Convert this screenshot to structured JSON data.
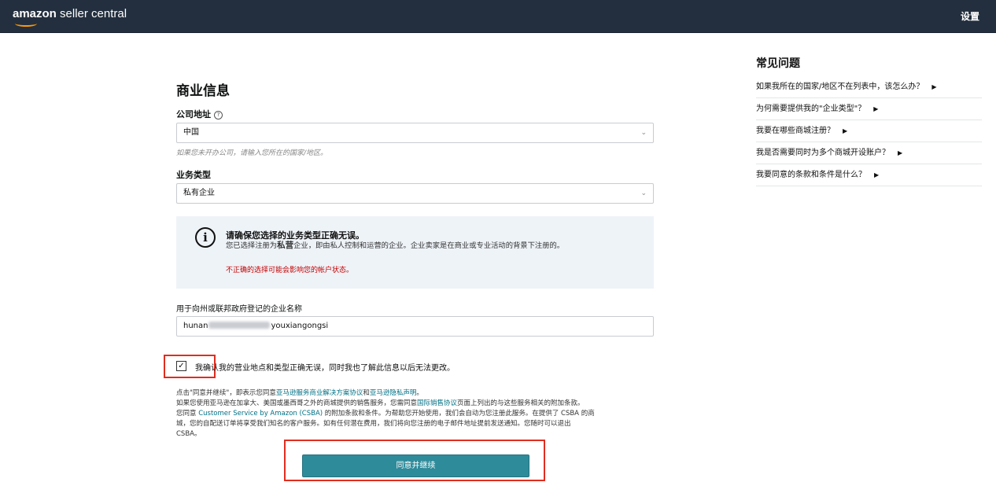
{
  "header": {
    "logo_brand": "amazon",
    "logo_rest": " seller central",
    "settings_label": "设置"
  },
  "form": {
    "title": "商业信息",
    "address_label": "公司地址",
    "address_value": "中国",
    "address_hint": "如果您未开办公司，请输入您所在的国家/地区。",
    "business_type_label": "业务类型",
    "business_type_value": "私有企业",
    "alert": {
      "title": "请确保您选择的业务类型正确无误。",
      "body_prefix": "您已选择注册为",
      "body_strong": "私营",
      "body_suffix": "企业，即由私人控制和运营的企业。企业卖家是在商业或专业活动的背景下注册的。",
      "warning": "不正确的选择可能会影响您的帐户状态。"
    },
    "company_name_label": "用于向州或联邦政府登记的企业名称",
    "company_name_prefix": "hunan",
    "company_name_suffix": "youxiangongsi",
    "confirm_checked": true,
    "confirm_text": "我确认我的营业地点和类型正确无误，同时我也了解此信息以后无法更改。",
    "legal": {
      "l1_a": "点击\"同意并继续\"，即表示您同意",
      "l1_link1": "亚马逊服务商业解决方案协议",
      "l1_b": "和",
      "l1_link2": "亚马逊隐私声明",
      "l1_c": "。",
      "l2_a": "如果您使用亚马逊在加拿大、美国或墨西哥之外的商城提供的销售服务，您需同意",
      "l2_link": "国际销售协议",
      "l2_b": "页面上列出的与这些服务相关的附加条款。",
      "l3_a": "您同意 ",
      "l3_link": "Customer Service by Amazon (CSBA)",
      "l3_b": " 的附加条款和条件。为帮助您开始使用，我们会自动为您注册此服务。在提供了 CSBA 的商",
      "l4": "城，您的自配送订单将享受我们知名的客户服务。如有任何潜在费用，我们将向您注册的电子邮件地址提前发送通知。您随时可以退出",
      "l5": "CSBA。"
    },
    "submit_label": "同意并继续"
  },
  "faq": {
    "title": "常见问题",
    "items": [
      "如果我所在的国家/地区不在列表中，该怎么办？",
      "为何需要提供我的\"企业类型\"？",
      "我要在哪些商城注册？",
      "我是否需要同时为多个商城开设账户？",
      "我要同意的条款和条件是什么？"
    ]
  },
  "icons": {
    "info": "info-circle-icon",
    "help": "help-circle-icon",
    "chevron": "chevron-down-icon",
    "expand": "triangle-right-icon",
    "check": "checkmark-icon"
  },
  "colors": {
    "header_bg": "#232f3e",
    "accent_orange": "#ff9900",
    "button_bg": "#2e8b9a",
    "link": "#007185",
    "warning": "#c40000",
    "highlight_box": "#e02d1f"
  }
}
